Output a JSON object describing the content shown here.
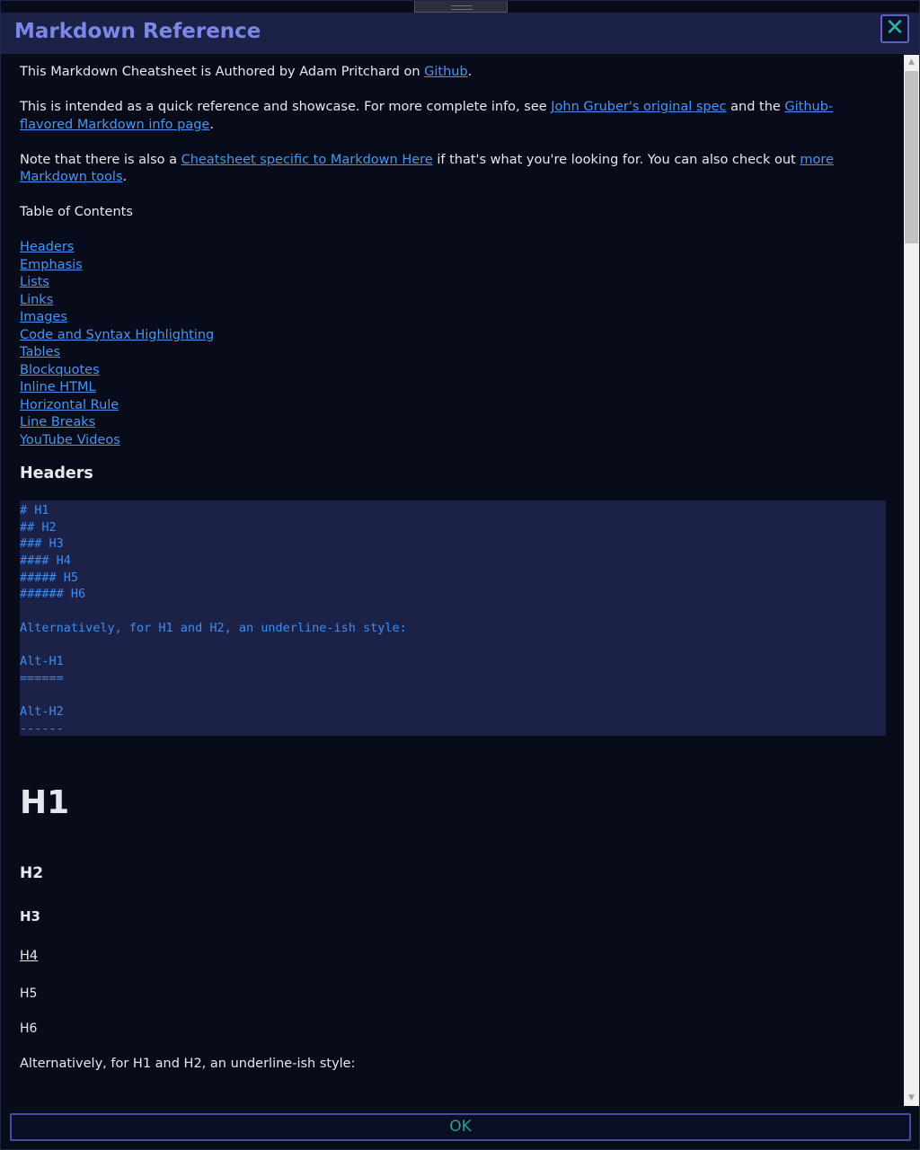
{
  "window": {
    "title": "Markdown Reference"
  },
  "intro": {
    "p1_pre": "This Markdown Cheatsheet is Authored by Adam Pritchard on ",
    "p1_link": "Github",
    "p1_post": ".",
    "p2_pre": "This is intended as a quick reference and showcase. For more complete info, see ",
    "p2_link1": "John Gruber's original spec",
    "p2_mid": " and the ",
    "p2_link2": "Github-flavored Markdown info page",
    "p2_post": ".",
    "p3_pre": "Note that there is also a ",
    "p3_link1": "Cheatsheet specific to Markdown Here",
    "p3_mid": " if that's what you're looking for. You can also check out ",
    "p3_link2": "more Markdown tools",
    "p3_post": "."
  },
  "toc": {
    "heading": "Table of Contents",
    "items": [
      "Headers",
      "Emphasis",
      "Lists",
      "Links",
      "Images",
      "Code and Syntax Highlighting",
      "Tables",
      "Blockquotes",
      "Inline HTML",
      "Horizontal Rule",
      "Line Breaks",
      "YouTube Videos"
    ]
  },
  "headers_section": {
    "title": "Headers",
    "code_lines": [
      "# H1",
      "## H2",
      "### H3",
      "#### H4",
      "##### H5",
      "###### H6",
      "",
      "Alternatively, for H1 and H2, an underline-ish style:",
      "",
      "Alt-H1",
      "======",
      "",
      "Alt-H2",
      "------"
    ],
    "h1": "H1",
    "h2": "H2",
    "h3": "H3",
    "h4": "H4",
    "h5": "H5",
    "h6": "H6",
    "alt_text": "Alternatively, for H1 and H2, an underline-ish style:"
  },
  "footer": {
    "ok_label": "OK"
  }
}
